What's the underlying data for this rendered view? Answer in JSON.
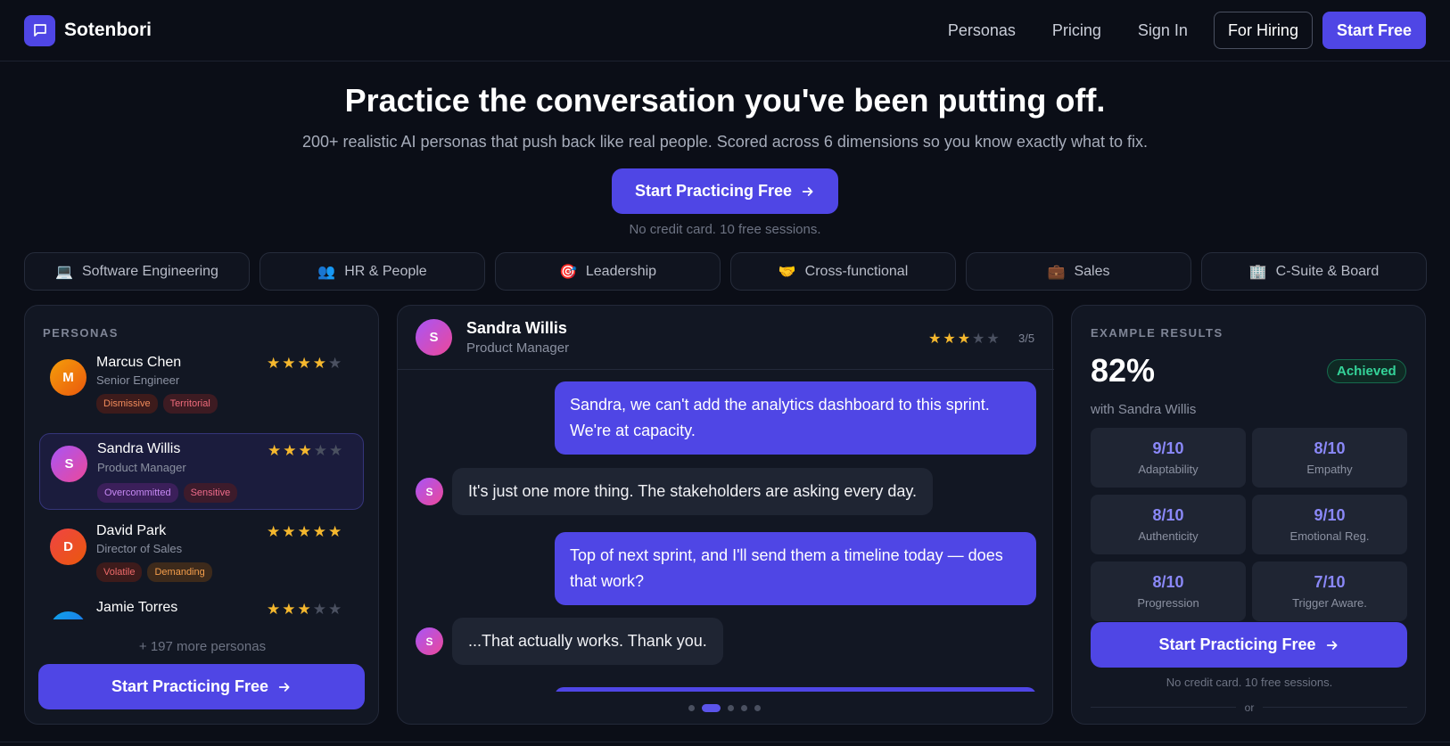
{
  "nav": {
    "brand": "Sotenbori",
    "links": [
      "Personas",
      "Pricing",
      "Sign In"
    ],
    "for_hiring": "For Hiring",
    "start_free": "Start Free"
  },
  "hero": {
    "title": "Practice the conversation you've been putting off.",
    "subtitle": "200+ realistic AI personas that push back like real people. Scored across 6 dimensions so you know exactly what to fix.",
    "cta": "Start Practicing Free",
    "note": "No credit card. 10 free sessions."
  },
  "categories": [
    {
      "icon": "💻",
      "label": "Software Engineering"
    },
    {
      "icon": "👥",
      "label": "HR & People"
    },
    {
      "icon": "🎯",
      "label": "Leadership"
    },
    {
      "icon": "🤝",
      "label": "Cross-functional"
    },
    {
      "icon": "💼",
      "label": "Sales"
    },
    {
      "icon": "🏢",
      "label": "C-Suite & Board"
    }
  ],
  "personas": {
    "label": "PERSONAS",
    "items": [
      {
        "initial": "M",
        "name": "Marcus Chen",
        "role": "Senior Engineer",
        "rating": 4,
        "tags": [
          "Dismissive",
          "Territorial"
        ]
      },
      {
        "initial": "S",
        "name": "Sandra Willis",
        "role": "Product Manager",
        "rating": 3,
        "tags": [
          "Overcommitted",
          "Sensitive"
        ]
      },
      {
        "initial": "D",
        "name": "David Park",
        "role": "Director of Sales",
        "rating": 5,
        "tags": [
          "Volatile",
          "Demanding"
        ]
      },
      {
        "initial": "",
        "name": "Jamie Torres",
        "role": "",
        "rating": 3,
        "tags": []
      }
    ],
    "more": "+ 197 more personas",
    "cta": "Start Practicing Free"
  },
  "chat": {
    "initial": "S",
    "name": "Sandra Willis",
    "role": "Product Manager",
    "rating": 3,
    "rating_label": "3/5",
    "messages": [
      {
        "from": "user",
        "text": "Sandra, we can't add the analytics dashboard to this sprint. We're at capacity."
      },
      {
        "from": "ai",
        "text": "It's just one more thing. The stakeholders are asking every day."
      },
      {
        "from": "user",
        "text": "Top of next sprint, and I'll send them a timeline today — does that work?"
      },
      {
        "from": "ai",
        "text": "...That actually works. Thank you."
      }
    ],
    "pages": 5,
    "active_page": 2
  },
  "results": {
    "label": "EXAMPLE RESULTS",
    "score": "82%",
    "badge": "Achieved",
    "with": "with Sandra Willis",
    "scores": [
      {
        "value": "9/10",
        "label": "Adaptability"
      },
      {
        "value": "8/10",
        "label": "Empathy"
      },
      {
        "value": "8/10",
        "label": "Authenticity"
      },
      {
        "value": "9/10",
        "label": "Emotional Reg."
      },
      {
        "value": "8/10",
        "label": "Progression"
      },
      {
        "value": "7/10",
        "label": "Trigger Aware."
      }
    ],
    "cta": "Start Practicing Free",
    "note": "No credit card. 10 free sessions.",
    "or": "or"
  },
  "colors": {
    "accent": "#4f46e5",
    "background": "#0b0e17",
    "star": "#f5b82e",
    "success": "#34d399"
  }
}
